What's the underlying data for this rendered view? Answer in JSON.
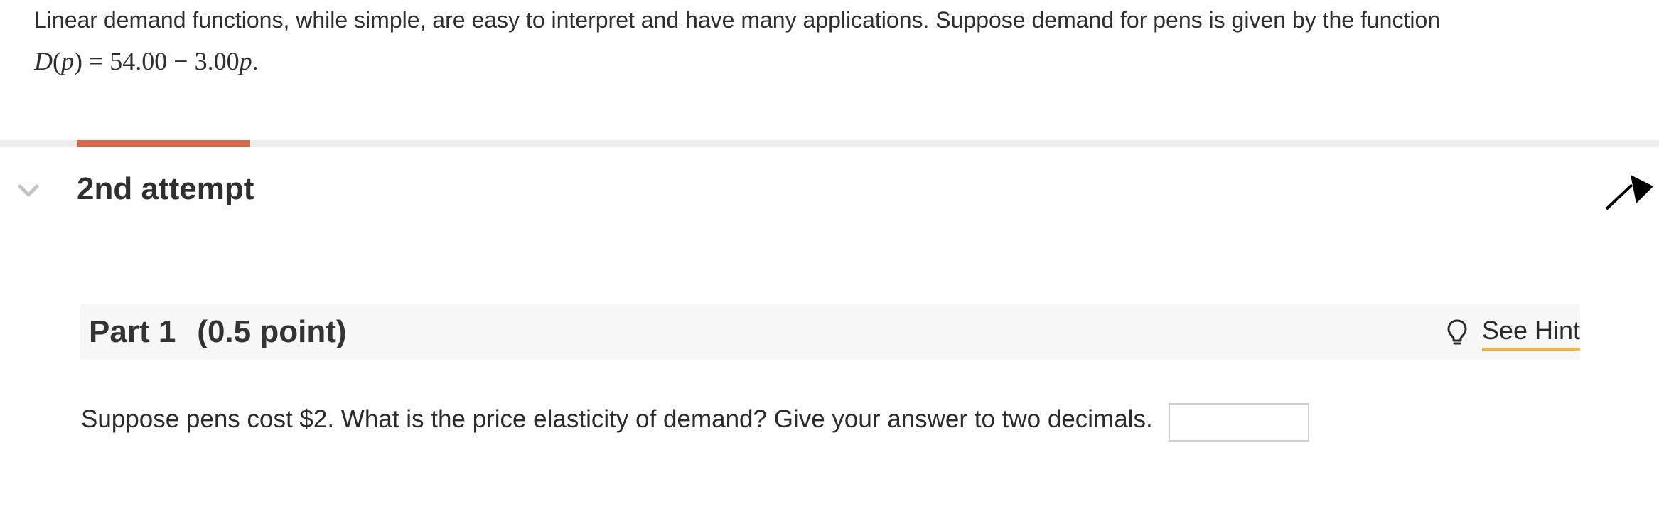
{
  "problem": {
    "intro": "Linear demand functions, while simple, are easy to interpret and have many applications. Suppose demand for pens is given by the function",
    "formula": {
      "lhs_fn": "D",
      "lhs_var": "p",
      "rhs": "= 54.00 − 3.00",
      "rhs_var": "p",
      "end": "."
    }
  },
  "attempt": {
    "title": "2nd attempt",
    "progress_fraction": 0.105,
    "icons": {
      "toggle": "chevron-down-icon",
      "cursor": "arrow-cursor-icon"
    }
  },
  "part": {
    "label": "Part 1",
    "points": "(0.5 point)",
    "hint": {
      "label": "See Hint",
      "icon": "lightbulb-icon"
    }
  },
  "question": {
    "text": "Suppose pens cost $2. What is the price elasticity of demand? Give your answer to two decimals.",
    "answer_value": ""
  },
  "colors": {
    "progress_accent": "#d9694b",
    "hint_underline": "#e8b64c",
    "part_bar_bg": "#f7f7f7"
  }
}
